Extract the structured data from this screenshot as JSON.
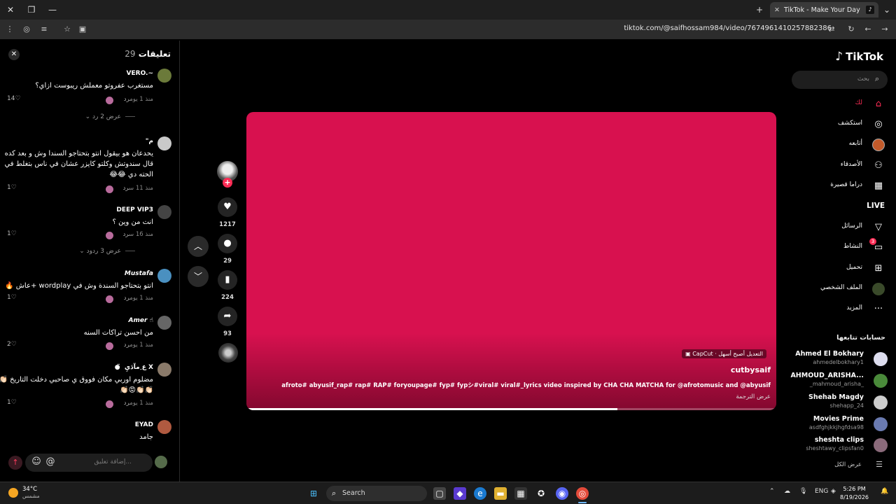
{
  "browser": {
    "tab_title": "TikTok - Make Your Day",
    "url": "tiktok.com/@saifhossam984/video/7674961410257882386"
  },
  "comments": {
    "title": "تعليقات",
    "count": "29",
    "input_placeholder": "إضافة تعليق...",
    "items": [
      {
        "user": "VERO.~",
        "text": "مستغرب عفروتو معملش ريبوست ازاي؟",
        "time": "منذ 1 يوم",
        "reply": "رد",
        "likes": "14",
        "view_replies": "عرض 2 رد"
      },
      {
        "user": "\"م",
        "text": "يحدعان هو بيقول انتو بتحتاجو السندا وش و بعد كده قال سندوتش وكلتو كايزر عشان في ناس بتغلط في الحته دي 😂😂",
        "time": "منذ 11 س",
        "reply": "رد",
        "likes": "1"
      },
      {
        "user": "DEEP VIP3",
        "text": "انت من وين ؟",
        "time": "منذ 16 س",
        "reply": "رد",
        "likes": "1",
        "view_replies": "عرض 3 ردود"
      },
      {
        "user": "Mustafa",
        "text": "انتو بتحتاجو السندة وش في wordplay +عاش 🔥",
        "time": "منذ 1 يوم",
        "reply": "رد",
        "likes": "1"
      },
      {
        "user": "Amer ☝",
        "text": "من احسن تراكات السنه",
        "time": "منذ 1 يوم",
        "reply": "رد",
        "likes": "2"
      },
      {
        "user": "● ̈ ع ِمآدَيِ X",
        "text": "مضلوم اوربي مكان فووق ي صاحبي دخلت التاريخ 👏🏻👏🏻👏🏻😡👏🏻",
        "time": "منذ 1 يوم",
        "reply": "رد",
        "likes": "1"
      },
      {
        "user": "EYAD",
        "text": "جامد"
      }
    ]
  },
  "video": {
    "author": "cutbysaif",
    "description": "afroto# abyusif_rap# rap# RAP# foryoupage# fyp# fypシ#viral# viral#_lyrics video inspired by CHA CHA MATCHA for @afrotomusic and @abyusif",
    "translate": "عرض الترجمة",
    "capcut_badge": "CapCut · التعديل أصبح أسهل",
    "progress": 0.7,
    "likes": "1217",
    "comments": "29",
    "saves": "224",
    "shares": "93"
  },
  "sidebar": {
    "logo": "TikTok",
    "search_placeholder": "بحث",
    "nav": [
      {
        "label": "لك",
        "icon": "home-icon"
      },
      {
        "label": "استكشف",
        "icon": "compass-icon"
      },
      {
        "label": "أتابعه",
        "icon": "following-icon"
      },
      {
        "label": "الأصدقاء",
        "icon": "friends-icon"
      },
      {
        "label": "دراما قصيرة",
        "icon": "drama-icon"
      },
      {
        "label": "LIVE",
        "icon": "live-icon"
      },
      {
        "label": "الرسائل",
        "icon": "messages-icon"
      },
      {
        "label": "النشاط",
        "icon": "activity-icon",
        "badge": "3"
      },
      {
        "label": "تحميل",
        "icon": "upload-icon"
      },
      {
        "label": "الملف الشخصي",
        "icon": "profile-icon"
      },
      {
        "label": "المزيد",
        "icon": "more-icon"
      }
    ],
    "following_title": "حسابات تتابعها",
    "following": [
      {
        "name": "Ahmed El Bokhary",
        "user": "ahmedelbokhary1"
      },
      {
        "name": "AHMOUD_ARISHA...",
        "user": "_mahmoud_arisha_"
      },
      {
        "name": "Shehab Magdy",
        "user": "shehapp_24"
      },
      {
        "name": "Movies Prime",
        "user": "asdfghjkkjhgfdsa98"
      },
      {
        "name": "sheshta clips",
        "user": "sheshtawy_clipsfan0"
      }
    ],
    "see_all": "عرض الكل"
  },
  "taskbar": {
    "temp": "34°C",
    "weather": "مشمس",
    "search": "Search",
    "lang": "ENG",
    "time": "5:26 PM",
    "date": "8/19/2026"
  },
  "colors": {
    "accent": "#fe2c55",
    "video_bg": "#d8114f"
  }
}
